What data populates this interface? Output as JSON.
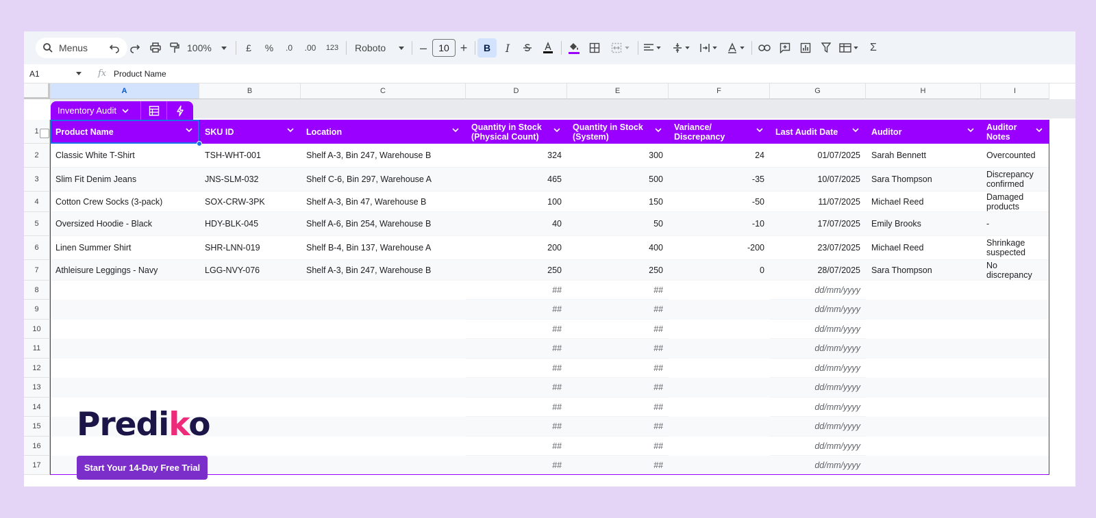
{
  "toolbar": {
    "menus_label": "Menus",
    "zoom": "100%",
    "currency": "£",
    "percent": "%",
    "dec_decrease": ".0",
    "dec_increase": ".00",
    "number_format": "123",
    "font": "Roboto",
    "font_size": "10",
    "bold": "B",
    "italic": "I",
    "sum": "Σ"
  },
  "formula_bar": {
    "cell_ref": "A1",
    "fx": "fx",
    "value": "Product Name"
  },
  "columns": [
    "A",
    "B",
    "C",
    "D",
    "E",
    "F",
    "G",
    "H",
    "I"
  ],
  "rows": [
    "1",
    "2",
    "3",
    "4",
    "5",
    "6",
    "7",
    "8",
    "9",
    "10",
    "11",
    "12",
    "13",
    "14",
    "15",
    "16",
    "17"
  ],
  "table": {
    "name": "Inventory Audit",
    "headers": [
      "Product Name",
      "SKU ID",
      "Location",
      "Quantity in Stock (Physical Count)",
      "Quantity in Stock (System)",
      "Variance/ Discrepancy",
      "Last Audit Date",
      "Auditor",
      "Auditor Notes"
    ],
    "data": [
      [
        "Classic White T-Shirt",
        "TSH-WHT-001",
        "Shelf A-3, Bin 247, Warehouse B",
        "324",
        "300",
        "24",
        "01/07/2025",
        "Sarah Bennett",
        "Overcounted"
      ],
      [
        "Slim Fit Denim Jeans",
        "JNS-SLM-032",
        "Shelf C-6, Bin 297, Warehouse A",
        "465",
        "500",
        "-35",
        "10/07/2025",
        "Sara Thompson",
        "Discrepancy confirmed"
      ],
      [
        "Cotton Crew Socks (3-pack)",
        "SOX-CRW-3PK",
        "Shelf A-3, Bin 47, Warehouse B",
        "100",
        "150",
        "-50",
        "11/07/2025",
        "Michael Reed",
        "Damaged products"
      ],
      [
        "Oversized Hoodie - Black",
        "HDY-BLK-045",
        "Shelf A-6, Bin 254, Warehouse B",
        "40",
        "50",
        "-10",
        "17/07/2025",
        "Emily Brooks",
        "-"
      ],
      [
        "Linen Summer Shirt",
        "SHR-LNN-019",
        "Shelf B-4, Bin 137, Warehouse A",
        "200",
        "400",
        "-200",
        "23/07/2025",
        "Michael Reed",
        "Shrinkage suspected"
      ],
      [
        "Athleisure Leggings - Navy",
        "LGG-NVY-076",
        "Shelf A-3, Bin 247, Warehouse B",
        "250",
        "250",
        "0",
        "28/07/2025",
        "Sara Thompson",
        "No discrepancy"
      ]
    ],
    "placeholder_number": "##",
    "placeholder_date": "dd/mm/yyyy"
  },
  "promo": {
    "logo_main": "Predi",
    "logo_k": "k",
    "logo_end": "o",
    "cta": "Start Your 14-Day Free Trial"
  },
  "colors": {
    "table_header": "#9900ff",
    "background": "#e4d4f6",
    "cta": "#7b2ec9",
    "logo_accent": "#ee2a7b"
  }
}
